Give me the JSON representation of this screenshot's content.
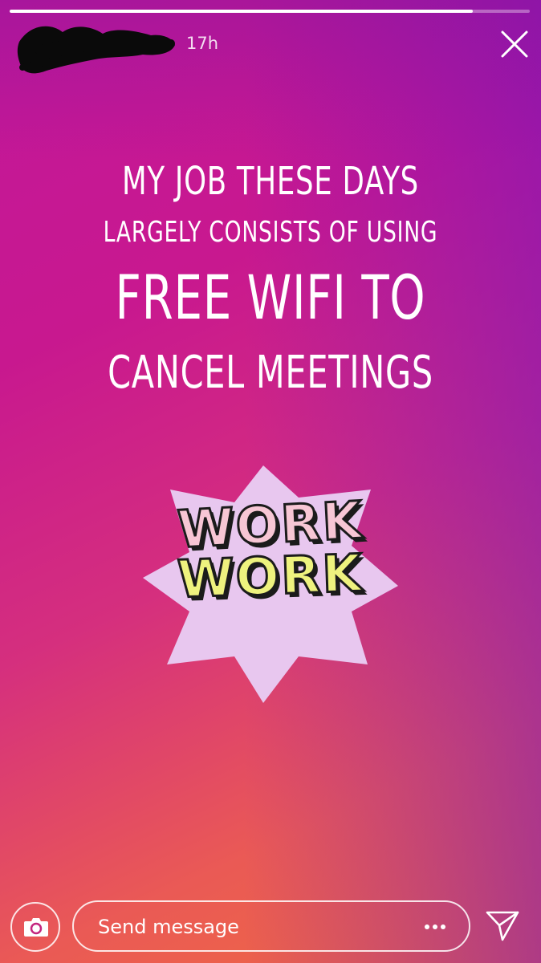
{
  "story": {
    "progress": 0.89,
    "time_ago": "17h",
    "text_lines": [
      "MY JOB THESE DAYS",
      "LARGELY CONSISTS OF USING",
      "FREE WIFI TO",
      "CANCEL MEETINGS"
    ],
    "sticker": {
      "words": [
        "WORK",
        "WORK"
      ]
    }
  },
  "footer": {
    "message_placeholder": "Send message"
  },
  "icons": {
    "close": "close-icon",
    "camera": "camera-icon",
    "more": "more-dots-icon",
    "send": "paper-plane-icon"
  },
  "colors": {
    "background_top": "#c2179a",
    "background_bottom": "#f06a3f",
    "text": "#ffffff",
    "sticker_bg": "#e8c7ef",
    "sticker_word1": "#f7c6d4",
    "sticker_word2": "#eef27e"
  }
}
